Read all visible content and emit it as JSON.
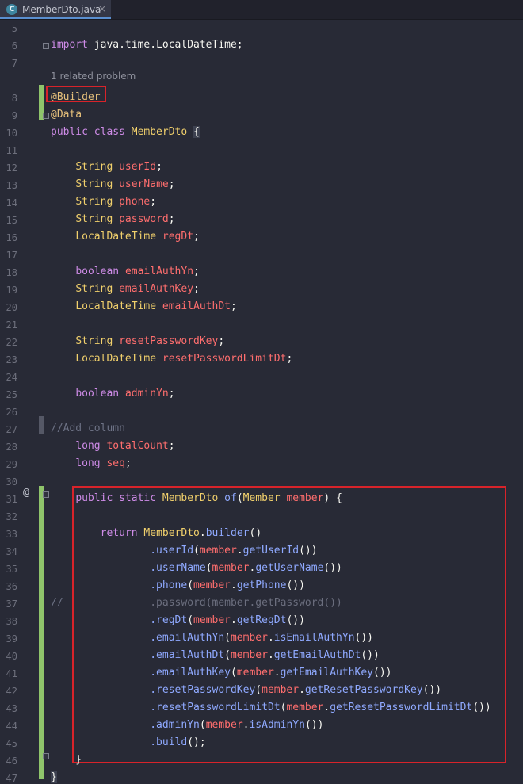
{
  "tab": {
    "icon_letter": "C",
    "name": "MemberDto.java",
    "close": "×"
  },
  "hint": "1 related problem",
  "lines": [
    {
      "n": "5"
    },
    {
      "n": "6",
      "t": [
        [
          "kw",
          "import "
        ],
        [
          "plain",
          "java.time.LocalDateTime;"
        ]
      ]
    },
    {
      "n": "7"
    },
    {
      "n": "8",
      "t": [
        [
          "ann",
          "@Builder"
        ]
      ]
    },
    {
      "n": "9",
      "t": [
        [
          "ann",
          "@Data"
        ]
      ]
    },
    {
      "n": "10",
      "t": [
        [
          "kw",
          "public class "
        ],
        [
          "type",
          "MemberDto "
        ],
        [
          "bracehl",
          "{"
        ]
      ]
    },
    {
      "n": "11"
    },
    {
      "n": "12",
      "t": [
        [
          "plain",
          "    "
        ],
        [
          "type",
          "String "
        ],
        [
          "field",
          "userId"
        ],
        [
          "plain",
          ";"
        ]
      ]
    },
    {
      "n": "13",
      "t": [
        [
          "plain",
          "    "
        ],
        [
          "type",
          "String "
        ],
        [
          "field",
          "userName"
        ],
        [
          "plain",
          ";"
        ]
      ]
    },
    {
      "n": "14",
      "t": [
        [
          "plain",
          "    "
        ],
        [
          "type",
          "String "
        ],
        [
          "field",
          "phone"
        ],
        [
          "plain",
          ";"
        ]
      ]
    },
    {
      "n": "15",
      "t": [
        [
          "plain",
          "    "
        ],
        [
          "type",
          "String "
        ],
        [
          "field",
          "password"
        ],
        [
          "plain",
          ";"
        ]
      ]
    },
    {
      "n": "16",
      "t": [
        [
          "plain",
          "    "
        ],
        [
          "type",
          "LocalDateTime "
        ],
        [
          "field",
          "regDt"
        ],
        [
          "plain",
          ";"
        ]
      ]
    },
    {
      "n": "17"
    },
    {
      "n": "18",
      "t": [
        [
          "plain",
          "    "
        ],
        [
          "kw",
          "boolean "
        ],
        [
          "field",
          "emailAuthYn"
        ],
        [
          "plain",
          ";"
        ]
      ]
    },
    {
      "n": "19",
      "t": [
        [
          "plain",
          "    "
        ],
        [
          "type",
          "String "
        ],
        [
          "field",
          "emailAuthKey"
        ],
        [
          "plain",
          ";"
        ]
      ]
    },
    {
      "n": "20",
      "t": [
        [
          "plain",
          "    "
        ],
        [
          "type",
          "LocalDateTime "
        ],
        [
          "field",
          "emailAuthDt"
        ],
        [
          "plain",
          ";"
        ]
      ]
    },
    {
      "n": "21"
    },
    {
      "n": "22",
      "t": [
        [
          "plain",
          "    "
        ],
        [
          "type",
          "String "
        ],
        [
          "field",
          "resetPasswordKey"
        ],
        [
          "plain",
          ";"
        ]
      ]
    },
    {
      "n": "23",
      "t": [
        [
          "plain",
          "    "
        ],
        [
          "type",
          "LocalDateTime "
        ],
        [
          "field",
          "resetPasswordLimitDt"
        ],
        [
          "plain",
          ";"
        ]
      ]
    },
    {
      "n": "24"
    },
    {
      "n": "25",
      "t": [
        [
          "plain",
          "    "
        ],
        [
          "kw",
          "boolean "
        ],
        [
          "field",
          "adminYn"
        ],
        [
          "plain",
          ";"
        ]
      ]
    },
    {
      "n": "26"
    },
    {
      "n": "27",
      "t": [
        [
          "cmt",
          "//Add column"
        ]
      ]
    },
    {
      "n": "28",
      "t": [
        [
          "plain",
          "    "
        ],
        [
          "kw",
          "long "
        ],
        [
          "field",
          "totalCount"
        ],
        [
          "plain",
          ";"
        ]
      ]
    },
    {
      "n": "29",
      "t": [
        [
          "plain",
          "    "
        ],
        [
          "kw",
          "long "
        ],
        [
          "field",
          "seq"
        ],
        [
          "plain",
          ";"
        ]
      ]
    },
    {
      "n": "30"
    },
    {
      "n": "31",
      "t": [
        [
          "plain",
          "    "
        ],
        [
          "kw",
          "public static "
        ],
        [
          "type",
          "MemberDto "
        ],
        [
          "method",
          "of"
        ],
        [
          "plain",
          "("
        ],
        [
          "type",
          "Member "
        ],
        [
          "field",
          "member"
        ],
        [
          "plain",
          ") {"
        ]
      ]
    },
    {
      "n": "32"
    },
    {
      "n": "33",
      "t": [
        [
          "plain",
          "        "
        ],
        [
          "kw",
          "return "
        ],
        [
          "type",
          "MemberDto"
        ],
        [
          "plain",
          "."
        ],
        [
          "method",
          "builder"
        ],
        [
          "plain",
          "()"
        ]
      ]
    },
    {
      "n": "34",
      "t": [
        [
          "plain",
          "                "
        ],
        [
          "method",
          ".userId"
        ],
        [
          "plain",
          "("
        ],
        [
          "field",
          "member"
        ],
        [
          "plain",
          "."
        ],
        [
          "method",
          "getUserId"
        ],
        [
          "plain",
          "())"
        ]
      ]
    },
    {
      "n": "35",
      "t": [
        [
          "plain",
          "                "
        ],
        [
          "method",
          ".userName"
        ],
        [
          "plain",
          "("
        ],
        [
          "field",
          "member"
        ],
        [
          "plain",
          "."
        ],
        [
          "method",
          "getUserName"
        ],
        [
          "plain",
          "())"
        ]
      ]
    },
    {
      "n": "36",
      "t": [
        [
          "plain",
          "                "
        ],
        [
          "method",
          ".phone"
        ],
        [
          "plain",
          "("
        ],
        [
          "field",
          "member"
        ],
        [
          "plain",
          "."
        ],
        [
          "method",
          "getPhone"
        ],
        [
          "plain",
          "())"
        ]
      ]
    },
    {
      "n": "37",
      "t": [
        [
          "cmt",
          "//              "
        ],
        [
          "dim",
          ".password(member.getPassword())"
        ]
      ]
    },
    {
      "n": "38",
      "t": [
        [
          "plain",
          "                "
        ],
        [
          "method",
          ".regDt"
        ],
        [
          "plain",
          "("
        ],
        [
          "field",
          "member"
        ],
        [
          "plain",
          "."
        ],
        [
          "method",
          "getRegDt"
        ],
        [
          "plain",
          "())"
        ]
      ]
    },
    {
      "n": "39",
      "t": [
        [
          "plain",
          "                "
        ],
        [
          "method",
          ".emailAuthYn"
        ],
        [
          "plain",
          "("
        ],
        [
          "field",
          "member"
        ],
        [
          "plain",
          "."
        ],
        [
          "method",
          "isEmailAuthYn"
        ],
        [
          "plain",
          "())"
        ]
      ]
    },
    {
      "n": "40",
      "t": [
        [
          "plain",
          "                "
        ],
        [
          "method",
          ".emailAuthDt"
        ],
        [
          "plain",
          "("
        ],
        [
          "field",
          "member"
        ],
        [
          "plain",
          "."
        ],
        [
          "method",
          "getEmailAuthDt"
        ],
        [
          "plain",
          "())"
        ]
      ]
    },
    {
      "n": "41",
      "t": [
        [
          "plain",
          "                "
        ],
        [
          "method",
          ".emailAuthKey"
        ],
        [
          "plain",
          "("
        ],
        [
          "field",
          "member"
        ],
        [
          "plain",
          "."
        ],
        [
          "method",
          "getEmailAuthKey"
        ],
        [
          "plain",
          "())"
        ]
      ]
    },
    {
      "n": "42",
      "t": [
        [
          "plain",
          "                "
        ],
        [
          "method",
          ".resetPasswordKey"
        ],
        [
          "plain",
          "("
        ],
        [
          "field",
          "member"
        ],
        [
          "plain",
          "."
        ],
        [
          "method",
          "getResetPasswordKey"
        ],
        [
          "plain",
          "())"
        ]
      ]
    },
    {
      "n": "43",
      "t": [
        [
          "plain",
          "                "
        ],
        [
          "method",
          ".resetPasswordLimitDt"
        ],
        [
          "plain",
          "("
        ],
        [
          "field",
          "member"
        ],
        [
          "plain",
          "."
        ],
        [
          "method",
          "getResetPasswordLimitDt"
        ],
        [
          "plain",
          "())"
        ]
      ]
    },
    {
      "n": "44",
      "t": [
        [
          "plain",
          "                "
        ],
        [
          "method",
          ".adminYn"
        ],
        [
          "plain",
          "("
        ],
        [
          "field",
          "member"
        ],
        [
          "plain",
          "."
        ],
        [
          "method",
          "isAdminYn"
        ],
        [
          "plain",
          "())"
        ]
      ]
    },
    {
      "n": "45",
      "t": [
        [
          "plain",
          "                "
        ],
        [
          "method",
          ".build"
        ],
        [
          "plain",
          "();"
        ]
      ]
    },
    {
      "n": "46",
      "t": [
        [
          "plain",
          "    }"
        ]
      ]
    },
    {
      "n": "47",
      "t": [
        [
          "bracehl",
          "}"
        ]
      ]
    }
  ],
  "override_marker": "@",
  "colors": {
    "background": "#282a36",
    "highlight_box": "#d8232a",
    "vcs_added": "#8fc46b"
  }
}
